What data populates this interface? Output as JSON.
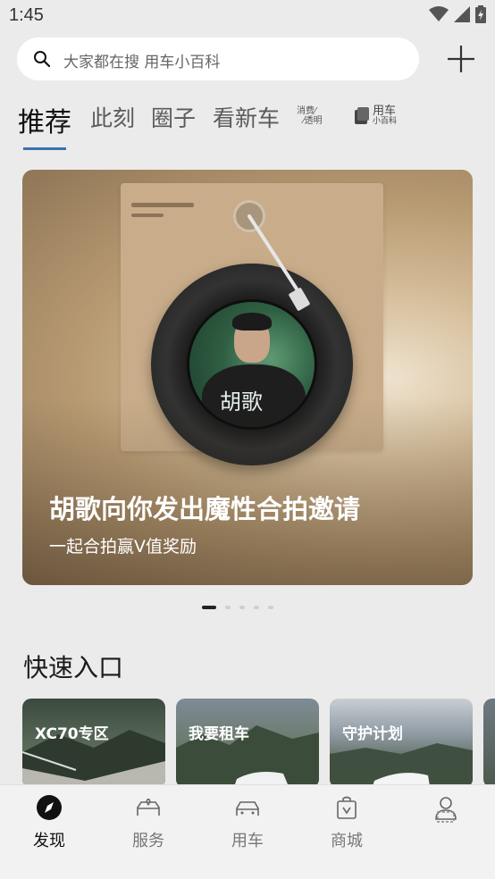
{
  "status_bar": {
    "time": "1:45",
    "icons": [
      "wifi-icon",
      "signal-icon",
      "battery-icon"
    ]
  },
  "search": {
    "placeholder": "大家都在搜 用车小百科"
  },
  "tabs": {
    "recommend": "推荐",
    "now": "此刻",
    "circle": "圈子",
    "new_car": "看新车",
    "consumption_top": "消费",
    "consumption_bottom": "透明",
    "encyclopedia_top": "用车",
    "encyclopedia_bottom": "小百科"
  },
  "banner": {
    "title": "胡歌向你发出魔性合拍邀请",
    "subtitle": "一起合拍赢V值奖励",
    "record_name": "胡歌"
  },
  "carousel": {
    "count": 5,
    "active_index": 0
  },
  "quick_entry": {
    "title": "快速入口",
    "items": [
      {
        "label": "XC70专区"
      },
      {
        "label": "我要租车"
      },
      {
        "label": "守护计划"
      }
    ]
  },
  "bottom_nav": {
    "items": [
      {
        "label": "发现",
        "icon": "compass-icon",
        "active": true
      },
      {
        "label": "服务",
        "icon": "car-heart-icon",
        "active": false
      },
      {
        "label": "用车",
        "icon": "car-icon",
        "active": false
      },
      {
        "label": "商城",
        "icon": "shopping-bag-icon",
        "active": false
      },
      {
        "label": "",
        "icon": "profile-icon",
        "active": false
      }
    ]
  },
  "colors": {
    "accent": "#3d6fb0",
    "background": "#ebebeb"
  }
}
